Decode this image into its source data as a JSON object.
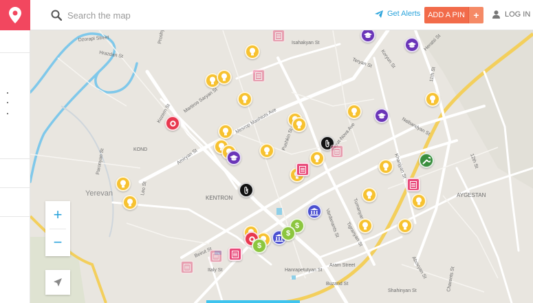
{
  "header": {
    "search_placeholder": "Search the map",
    "alerts_label": "Get Alerts",
    "add_pin_label": "ADD A PIN",
    "add_pin_plus": "+",
    "login_label": "LOG IN"
  },
  "colors": {
    "brand": "#f2475f",
    "accent_blue": "#29a3db",
    "add_pin": "#f26b4a",
    "pin_yellow": "#f7c230",
    "pin_purple": "#6a35b8",
    "pin_red": "#e8384f",
    "pin_green": "#8cc63f",
    "pin_darkgreen": "#3a8f3f",
    "pin_pink": "#e84a7a",
    "pin_black": "#111111",
    "pin_blue": "#4a4fd0"
  },
  "map": {
    "street_labels": [
      "Dzorapi Street",
      "Hrazdan St",
      "Proshyan St",
      "Isahakyan St",
      "Teryan St",
      "Koryun St",
      "Heratsi St",
      "Martiros Saryan St",
      "Mesrop Mashtots Ave",
      "Nalbandyan St",
      "Sayat-Nova Ave",
      "Kozern St",
      "Pushkin St",
      "Amiryan St",
      "Paronyan St",
      "Leo St",
      "Tumanyan St",
      "Khanjyan St",
      "Vardanants St",
      "Tigranyan St",
      "Aram St",
      "Hanrapetutyan St",
      "Beirut St",
      "Italy St",
      "Buzand St",
      "Khanjyan St",
      "Abovyan St",
      "Charents St",
      "Shahinyan St",
      "Saryan St",
      "Yerevan",
      "Kentron",
      "Aygestan",
      "Kond",
      "12th St",
      "11th St"
    ]
  },
  "controls": {
    "zoom_in": "+",
    "zoom_out": "−"
  },
  "icons": [
    "logo-pin-icon",
    "search-icon",
    "telegram-icon",
    "user-icon",
    "lightbulb-icon",
    "graduation-cap-icon",
    "paperclip-icon",
    "wrench-icon",
    "document-icon",
    "bank-icon",
    "money-icon",
    "locate-arrow-icon"
  ]
}
